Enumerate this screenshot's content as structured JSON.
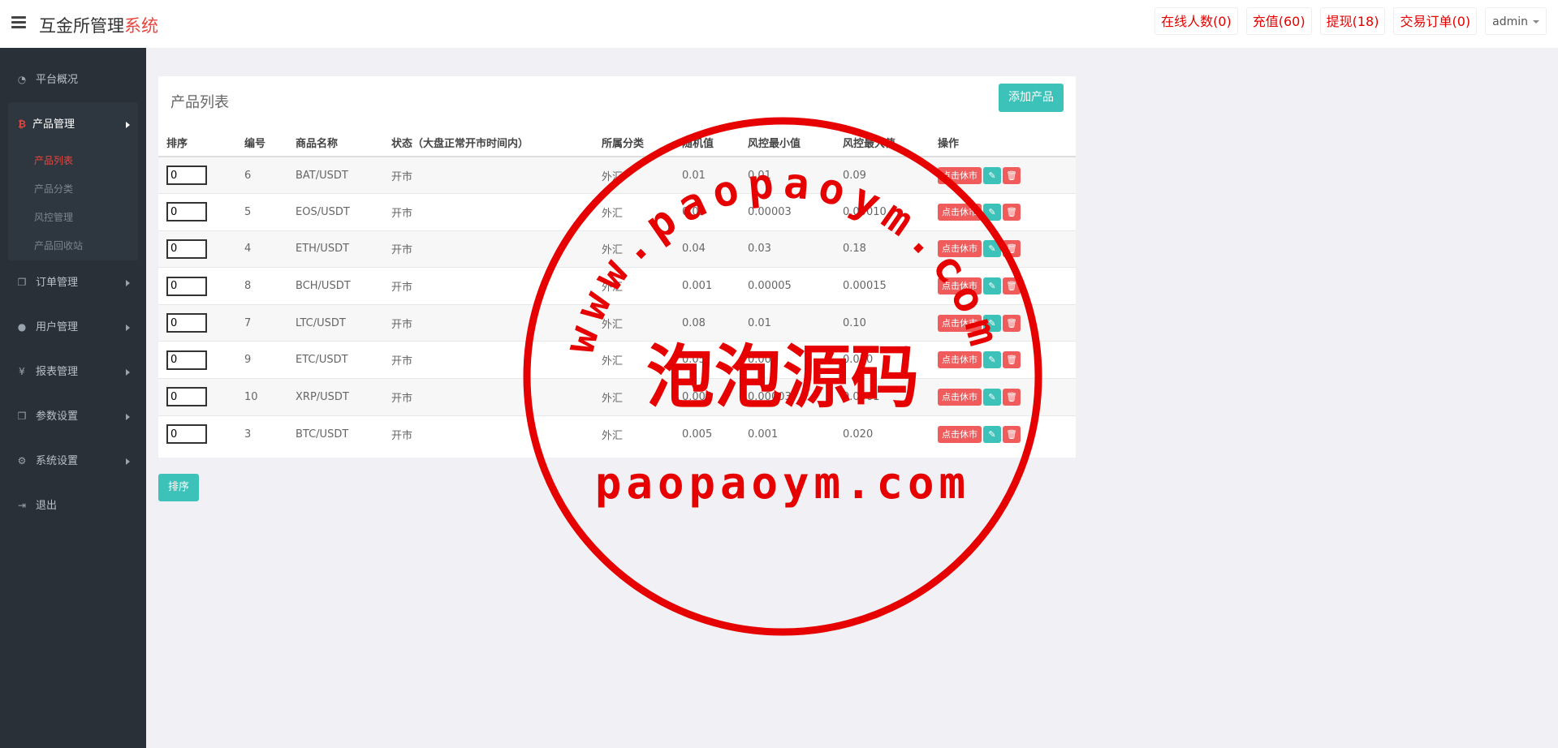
{
  "header": {
    "brand_main": "互金所管理",
    "brand_accent": "系统",
    "nav": [
      {
        "label": "在线人数(0)"
      },
      {
        "label": "充值(60)"
      },
      {
        "label": "提现(18)"
      },
      {
        "label": "交易订单(0)"
      }
    ],
    "user": "admin"
  },
  "sidebar": {
    "items": [
      {
        "label": "平台概况",
        "icon": "dashboard-icon"
      },
      {
        "label": "产品管理",
        "icon": "bitcoin-icon"
      },
      {
        "label": "订单管理",
        "icon": "copy-icon"
      },
      {
        "label": "用户管理",
        "icon": "user-icon"
      },
      {
        "label": "报表管理",
        "icon": "yen-icon"
      },
      {
        "label": "参数设置",
        "icon": "copy-icon"
      },
      {
        "label": "系统设置",
        "icon": "gears-icon"
      },
      {
        "label": "退出",
        "icon": "sign-out-icon"
      }
    ],
    "sub_items": [
      {
        "label": "产品列表",
        "active": true
      },
      {
        "label": "产品分类"
      },
      {
        "label": "风控管理"
      },
      {
        "label": "产品回收站"
      }
    ]
  },
  "panel": {
    "title": "产品列表",
    "add_label": "添加产品",
    "columns": [
      "排序",
      "编号",
      "商品名称",
      "状态（大盘正常开市时间内）",
      "所属分类",
      "随机值",
      "风控最小值",
      "风控最大值",
      "操作"
    ],
    "rows": [
      {
        "sort": "0",
        "id": "6",
        "name": "BAT/USDT",
        "status": "开市",
        "category": "外汇",
        "random": "0.01",
        "min": "0.01",
        "max": "0.09"
      },
      {
        "sort": "0",
        "id": "5",
        "name": "EOS/USDT",
        "status": "开市",
        "category": "外汇",
        "random": "0.05",
        "min": "0.00003",
        "max": "0.00010"
      },
      {
        "sort": "0",
        "id": "4",
        "name": "ETH/USDT",
        "status": "开市",
        "category": "外汇",
        "random": "0.04",
        "min": "0.03",
        "max": "0.18"
      },
      {
        "sort": "0",
        "id": "8",
        "name": "BCH/USDT",
        "status": "开市",
        "category": "外汇",
        "random": "0.001",
        "min": "0.00005",
        "max": "0.00015"
      },
      {
        "sort": "0",
        "id": "7",
        "name": "LTC/USDT",
        "status": "开市",
        "category": "外汇",
        "random": "0.08",
        "min": "0.01",
        "max": "0.10"
      },
      {
        "sort": "0",
        "id": "9",
        "name": "ETC/USDT",
        "status": "开市",
        "category": "外汇",
        "random": "0.05",
        "min": "0.003",
        "max": "0.010"
      },
      {
        "sort": "0",
        "id": "10",
        "name": "XRP/USDT",
        "status": "开市",
        "category": "外汇",
        "random": "0.005",
        "min": "0.00003",
        "max": "0.0001"
      },
      {
        "sort": "0",
        "id": "3",
        "name": "BTC/USDT",
        "status": "开市",
        "category": "外汇",
        "random": "0.005",
        "min": "0.001",
        "max": "0.020"
      }
    ],
    "action_label": "点击休市",
    "sort_button": "排序"
  },
  "watermark": {
    "arc_text": "www.paopaoym.com",
    "center_text": "泡泡源码",
    "bottom_text": "paopaoym.com",
    "color": "#e60000"
  }
}
